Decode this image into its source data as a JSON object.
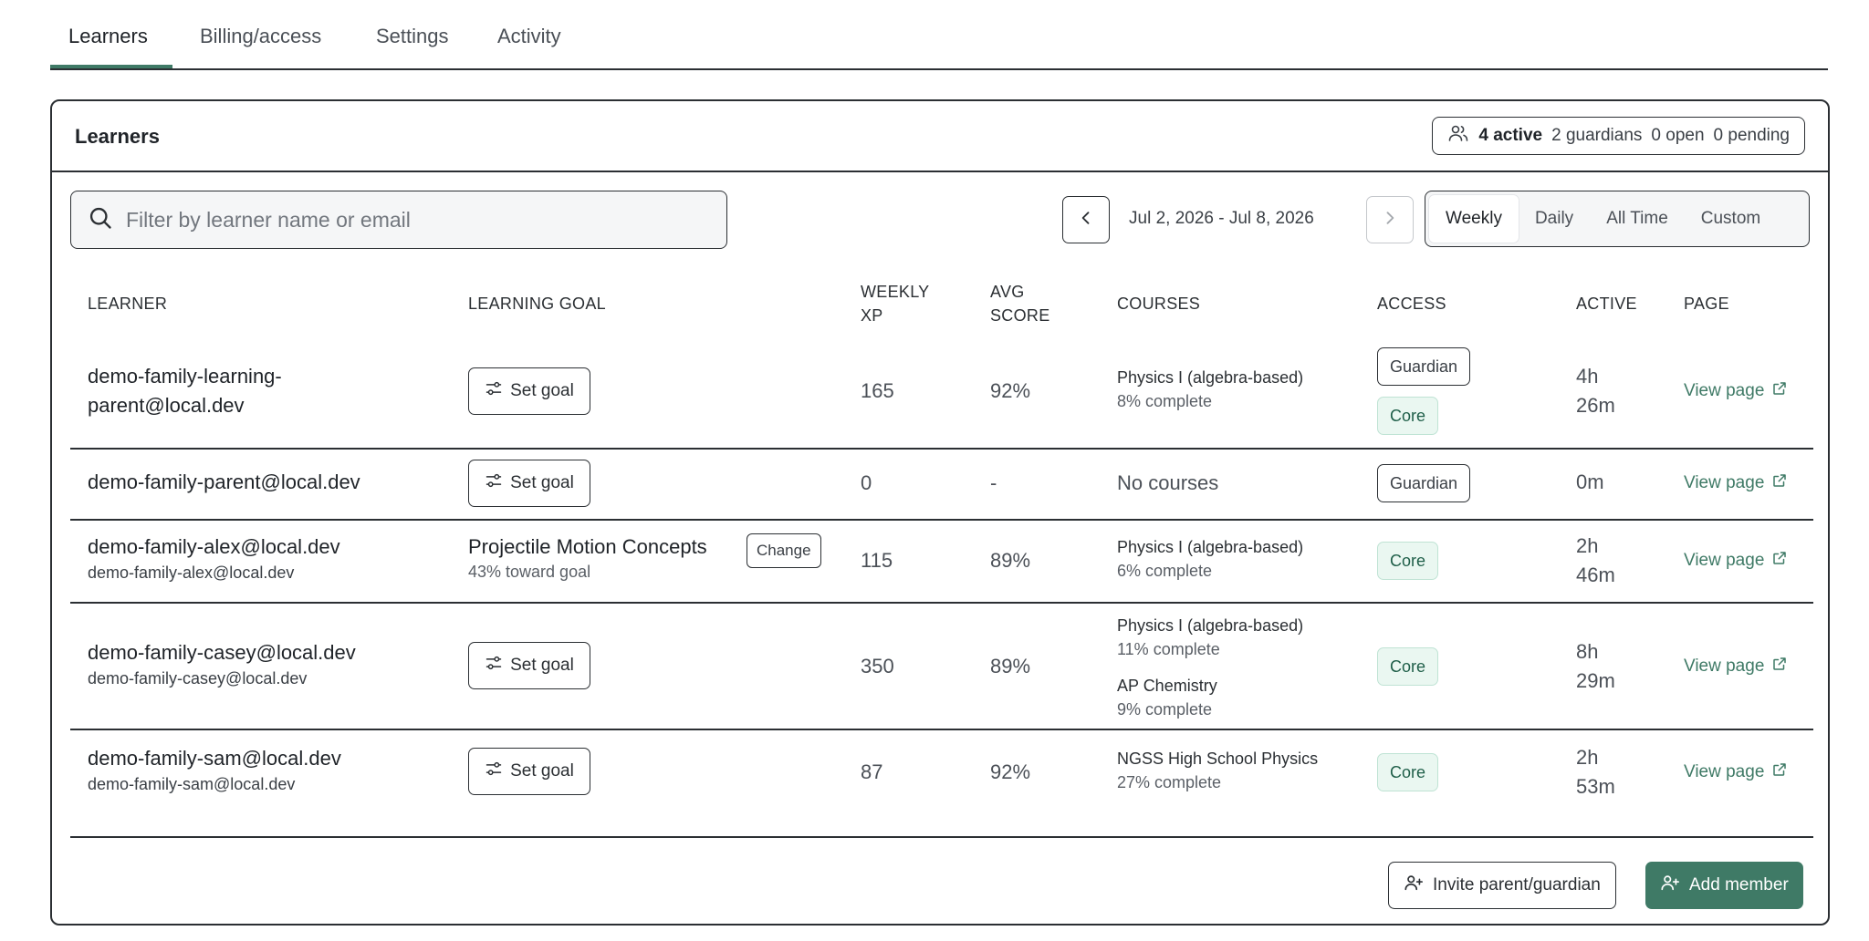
{
  "tabs": [
    {
      "label": "Learners",
      "active": true
    },
    {
      "label": "Billing/access"
    },
    {
      "label": "Settings"
    },
    {
      "label": "Activity"
    }
  ],
  "card": {
    "title": "Learners",
    "stats": {
      "active": "4 active",
      "guardians": "2 guardians",
      "open": "0 open",
      "pending": "0 pending",
      "icon": "users-icon"
    }
  },
  "toolbar": {
    "search_placeholder": "Filter by learner name or email",
    "search_value": "",
    "date_range": "Jul 2, 2026 - Jul 8, 2026",
    "periods": [
      "Weekly",
      "Daily",
      "All Time",
      "Custom"
    ],
    "selected_period": "Weekly"
  },
  "table": {
    "headers": {
      "learner": "LEARNER",
      "goal": "LEARNING GOAL",
      "xp_line1": "WEEKLY",
      "xp_line2": "XP",
      "score_line1": "AVG",
      "score_line2": "SCORE",
      "courses": "COURSES",
      "access": "ACCESS",
      "active": "ACTIVE",
      "page": "PAGE"
    },
    "rows": [
      {
        "name_line1": "demo-family-learning-",
        "name_line2": "parent@local.dev",
        "goal_button": "Set goal",
        "xp": "165",
        "score": "92%",
        "course1_name": "Physics I (algebra-based)",
        "course1_pct": "8% complete",
        "access1": "Guardian",
        "access2": "Core",
        "active_line1": "4h",
        "active_line2": "26m",
        "link": "View page"
      },
      {
        "name": "demo-family-parent@local.dev",
        "goal_button": "Set goal",
        "xp": "0",
        "score": "-",
        "courses_empty": "No courses",
        "access1": "Guardian",
        "active": "0m",
        "link": "View page"
      },
      {
        "name": "demo-family-alex@local.dev",
        "email": "demo-family-alex@local.dev",
        "goal_title": "Projectile Motion Concepts",
        "goal_progress": "43% toward goal",
        "goal_change": "Change",
        "xp": "115",
        "score": "89%",
        "course1_name": "Physics I (algebra-based)",
        "course1_pct": "6% complete",
        "access1": "Core",
        "active_line1": "2h",
        "active_line2": "46m",
        "link": "View page"
      },
      {
        "name": "demo-family-casey@local.dev",
        "email": "demo-family-casey@local.dev",
        "goal_button": "Set goal",
        "xp": "350",
        "score": "89%",
        "course1_name": "Physics I (algebra-based)",
        "course1_pct": "11% complete",
        "course2_name": "AP Chemistry",
        "course2_pct": "9% complete",
        "access1": "Core",
        "active_line1": "8h",
        "active_line2": "29m",
        "link": "View page"
      },
      {
        "name": "demo-family-sam@local.dev",
        "email": "demo-family-sam@local.dev",
        "goal_button": "Set goal",
        "xp": "87",
        "score": "92%",
        "course1_name": "NGSS High School Physics",
        "course1_pct": "27% complete",
        "access1": "Core",
        "active_line1": "2h",
        "active_line2": "53m",
        "link": "View page"
      }
    ]
  },
  "footer": {
    "invite_label": "Invite parent/guardian",
    "add_label": "Add member"
  },
  "colors": {
    "accent": "#3f7a66",
    "core_badge_bg": "#eaf7f1",
    "border": "#2b2f33"
  }
}
